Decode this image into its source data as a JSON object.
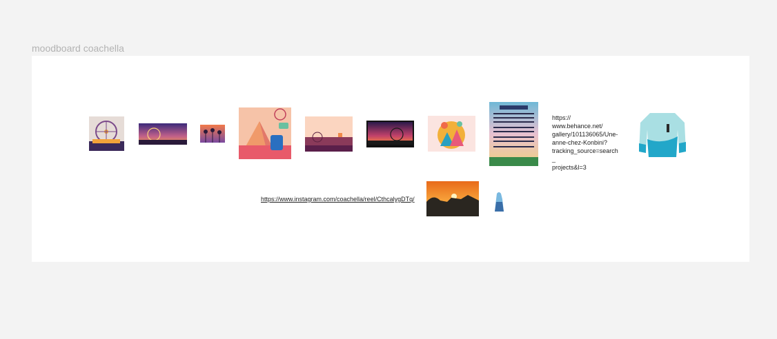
{
  "frame": {
    "title": "moodboard coachella"
  },
  "links": {
    "behance_lines": [
      "https://",
      "www.behance.net/",
      "gallery/101136065/Une-",
      "anne-chez-Konbini?",
      "tracking_source=search_",
      "projects&l=3"
    ],
    "instagram": "https://www.instagram.com/coachella/reel/CthcalygDTq/"
  },
  "images": [
    {
      "name": "ferris-wheel-illustration-image",
      "colors": [
        "#e9ddd6",
        "#7b4a8a"
      ]
    },
    {
      "name": "sunset-ferris-wheel-banner-image",
      "colors": [
        "#3b2a7a",
        "#f29a4a"
      ]
    },
    {
      "name": "palm-trees-sunset-image",
      "colors": [
        "#f06a4a",
        "#5a3e8c"
      ]
    },
    {
      "name": "coachella-poster-art-image",
      "colors": [
        "#f5c1a6",
        "#e85a6a"
      ]
    },
    {
      "name": "peach-sunset-landscape-image",
      "colors": [
        "#fbd3bd",
        "#6b2f5a"
      ]
    },
    {
      "name": "night-ferris-wheel-image",
      "colors": [
        "#2b1a4a",
        "#ff7a3a"
      ]
    },
    {
      "name": "festival-globe-illustration-image",
      "colors": [
        "#fbe3e0",
        "#f2a33a"
      ]
    },
    {
      "name": "coachella-lineup-poster-image",
      "colors": [
        "#6fb8d6",
        "#3a8a4a"
      ]
    },
    {
      "name": "tie-dye-sweatshirt-image",
      "colors": [
        "#a9dfe3",
        "#22a7c9"
      ]
    },
    {
      "name": "desert-sunset-image",
      "colors": [
        "#f08a1e",
        "#2a2620"
      ]
    },
    {
      "name": "blue-figure-image",
      "colors": [
        "#7ab9e0",
        "#3a6ea8"
      ]
    }
  ]
}
